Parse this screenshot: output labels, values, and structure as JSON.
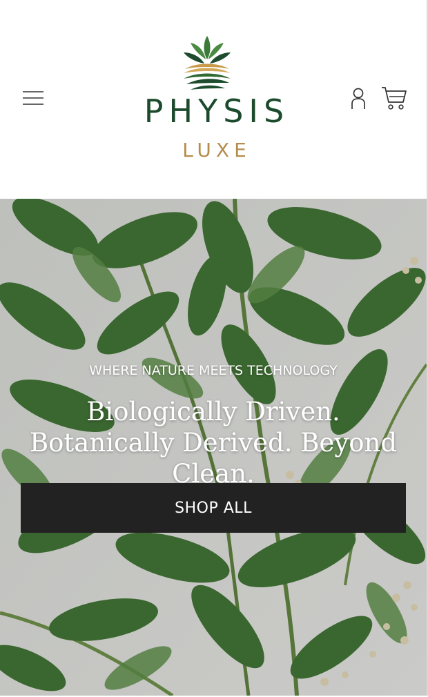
{
  "header": {
    "brand_name": "PHYSIS",
    "brand_sub": "LUXE",
    "icons": {
      "menu": "hamburger-menu-icon",
      "account": "user-icon",
      "cart": "cart-icon",
      "logo": "leaf-logo-icon"
    },
    "colors": {
      "brand_green": "#1c4a2c",
      "brand_gold": "#b48c4c"
    }
  },
  "hero": {
    "eyebrow": "WHERE NATURE MEETS TECHNOLOGY",
    "heading": "Biologically Driven. Botanically Derived. Beyond Clean.",
    "cta_label": "SHOP ALL",
    "cta_color": "#222222",
    "background": "botanical-leaves-image"
  }
}
